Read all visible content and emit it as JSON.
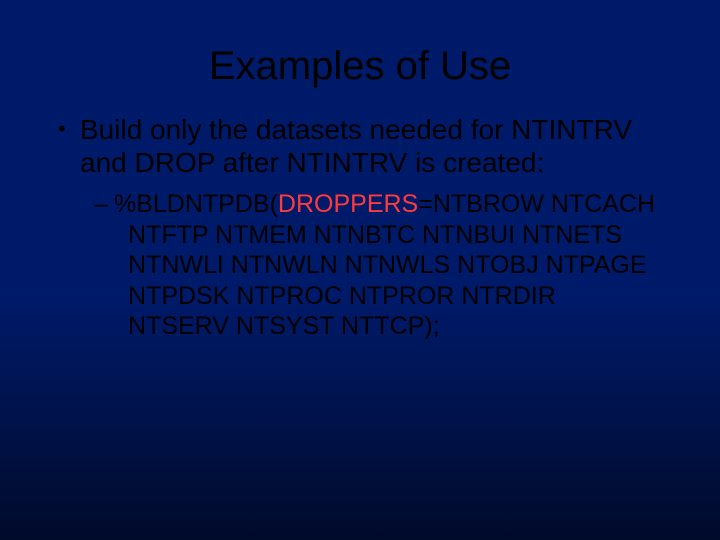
{
  "title": "Examples of Use",
  "bullet1": "Build only the datasets needed for NTINTRV and DROP after NTINTRV is created:",
  "sub": {
    "pre": "%BLDNTPDB(",
    "hl": "DROPPERS",
    "post": "=NTBROW NTCACH NTFTP NTMEM NTNBTC NTNBUI NTNETS NTNWLI NTNWLN NTNWLS NTOBJ NTPAGE NTPDSK NTPROC NTPROR NTRDIR NTSERV NTSYST NTTCP);"
  }
}
